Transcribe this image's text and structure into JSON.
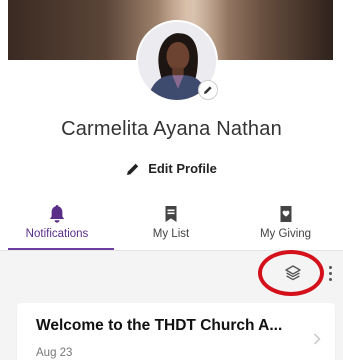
{
  "profile": {
    "name": "Carmelita Ayana Nathan",
    "edit_label": "Edit Profile"
  },
  "tabs": [
    {
      "label": "Notifications",
      "icon": "bell-icon",
      "active": true
    },
    {
      "label": "My List",
      "icon": "bookmark-icon",
      "active": false
    },
    {
      "label": "My Giving",
      "icon": "giving-icon",
      "active": false
    }
  ],
  "toolbar": {
    "layers_icon": "layers-icon",
    "more_icon": "kebab-menu-icon"
  },
  "notifications": [
    {
      "title": "Welcome to the THDT Church A...",
      "date": "Aug 23"
    }
  ],
  "colors": {
    "accent": "#5a2d88",
    "highlight": "#d4111a"
  }
}
